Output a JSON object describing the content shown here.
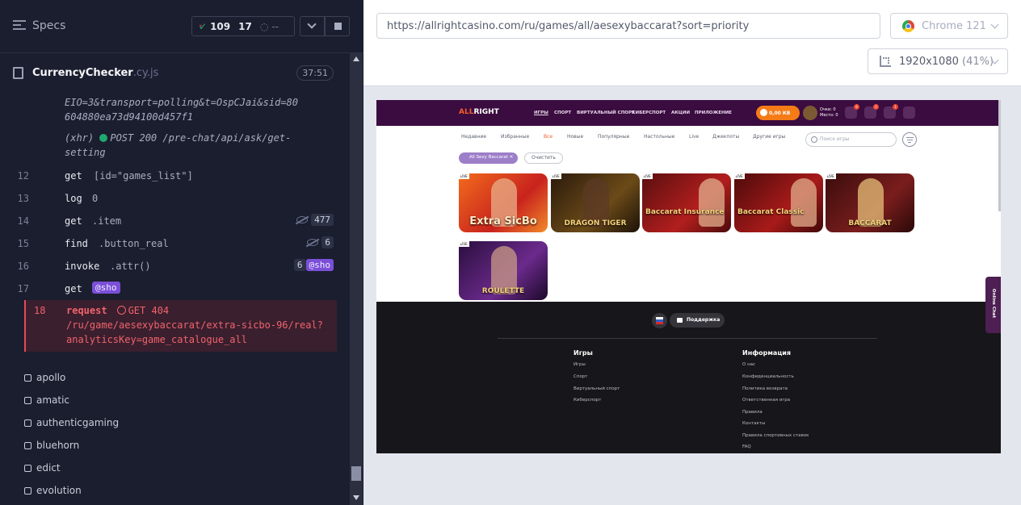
{
  "reporter": {
    "header_title": "Specs",
    "passed_count": "109",
    "failed_count": "17",
    "pending_text": "--",
    "spec_file_name": "CurrencyChecker",
    "spec_file_ext": ".cy.js",
    "spec_duration": "37:51",
    "continuation_text": "EIO=3&transport=polling&t=OspCJai&sid=80604880ea73d94100d457f1",
    "xhr_prefix": "(xhr)",
    "xhr_text": "POST 200 /pre-chat/api/ask/get-setting",
    "commands": [
      {
        "num": "12",
        "name": "get",
        "arg": "[id=\"games_list\"]"
      },
      {
        "num": "13",
        "name": "log",
        "arg": "0"
      },
      {
        "num": "14",
        "name": "get",
        "arg": ".item",
        "badge": "477"
      },
      {
        "num": "15",
        "name": "find",
        "arg": ".button_real",
        "badge": "6"
      },
      {
        "num": "16",
        "name": "invoke",
        "arg": ".attr()",
        "badge": "6",
        "alias": "@sho"
      },
      {
        "num": "17",
        "name": "get",
        "alias": "@sho"
      }
    ],
    "error_command": {
      "num": "18",
      "name": "request",
      "line1": "GET 404",
      "line2": "/ru/game/aesexybaccarat/extra-sicbo-96/real?",
      "line3": "analyticsKey=game_catalogue_all"
    },
    "suites": [
      "apollo",
      "amatic",
      "authenticgaming",
      "bluehorn",
      "edict",
      "evolution"
    ],
    "colors": {
      "passed": "#1fa971",
      "failed": "#e94a55",
      "alias": "#7b4fd8"
    }
  },
  "aut": {
    "url": "https://allrightcasino.com/ru/games/all/aesexybaccarat?sort=priority",
    "browser": "Chrome 121",
    "viewport_size": "1920x1080",
    "viewport_scale": "(41%)",
    "site": {
      "logo_left": "ALL",
      "logo_right": "RIGHT",
      "nav": [
        "ИГРЫ",
        "СПОРТ",
        "ВИРТУАЛЬНЫЙ СПОРТ",
        "КИБЕРСПОРТ",
        "АКЦИИ",
        "ПРИЛОЖЕНИЕ"
      ],
      "balance": "0,00 КВ",
      "points_label": "Очки: 0",
      "place_label": "Место: 0",
      "notif_badges": [
        "6",
        "0",
        "1"
      ],
      "filters": [
        "Недавние",
        "Избранные",
        "Все",
        "Новые",
        "Популярные",
        "Настольные",
        "Live",
        "Джекпоты",
        "Другие игры"
      ],
      "active_filter": "Все",
      "search_placeholder": "Поиск игры",
      "provider_chip": "All Sexy Baccarat",
      "clear_label": "Очистить",
      "games": [
        {
          "title": "Extra SicBo",
          "live": "LIVE"
        },
        {
          "title": "DRAGON TIGER",
          "live": "LIVE"
        },
        {
          "title": "Baccarat Insurance",
          "live": "LIVE"
        },
        {
          "title": "Baccarat Classic",
          "live": "LIVE"
        },
        {
          "title": "BACCARAT",
          "live": "LIVE"
        },
        {
          "title": "ROULETTE",
          "live": "LIVE"
        }
      ],
      "support_label": "Поддержка",
      "footer_col1_title": "Игры",
      "footer_col1_links": [
        "Игры",
        "Спорт",
        "Виртуальный спорт",
        "Киберспорт"
      ],
      "footer_col2_title": "Информация",
      "footer_col2_links": [
        "О нас",
        "Конфиденциальность",
        "Политика возврата",
        "Ответственная игра",
        "Правила",
        "Контакты",
        "Правила спортивных ставок",
        "FAQ"
      ],
      "online_chat": "Online Chat"
    }
  }
}
